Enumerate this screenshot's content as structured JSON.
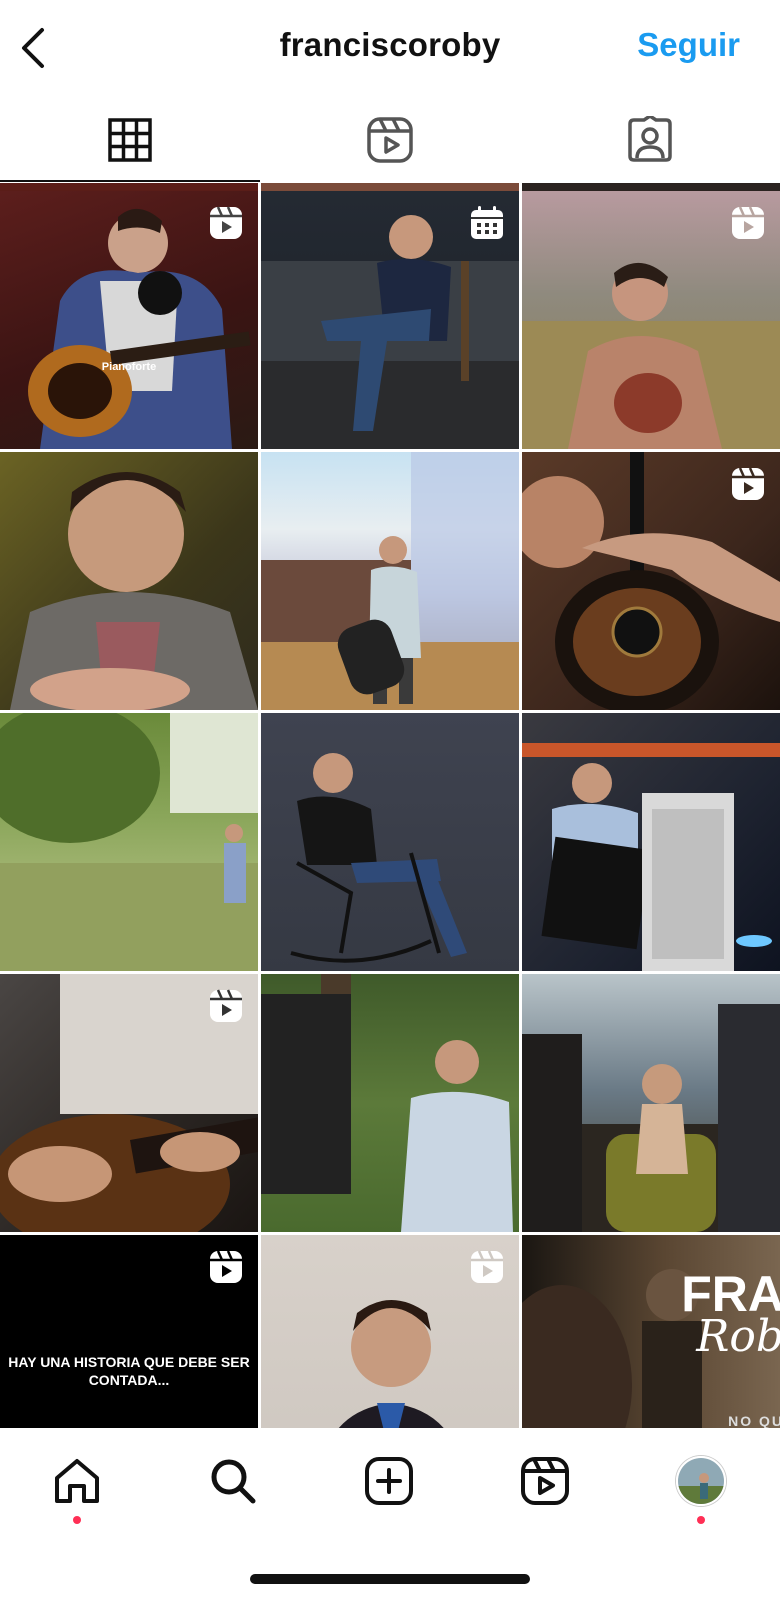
{
  "header": {
    "title": "franciscoroby",
    "follow_label": "Seguir"
  },
  "tabs": [
    {
      "name": "posts-grid",
      "icon": "grid-icon",
      "active": true
    },
    {
      "name": "reels",
      "icon": "reels-icon",
      "active": false
    },
    {
      "name": "tagged",
      "icon": "tagged-person-icon",
      "active": false
    }
  ],
  "posts": [
    {
      "badge": "reels-icon",
      "overlay": "Pianoforte"
    },
    {
      "badge": "calendar-icon"
    },
    {
      "badge": "reels-icon"
    },
    {
      "badge": ""
    },
    {
      "badge": ""
    },
    {
      "badge": "reels-icon"
    },
    {
      "badge": ""
    },
    {
      "badge": ""
    },
    {
      "badge": ""
    },
    {
      "badge": "reels-icon"
    },
    {
      "badge": ""
    },
    {
      "badge": ""
    },
    {
      "badge": "reels-icon",
      "overlay": "HAY UNA HISTORIA QUE DEBE SER CONTADA..."
    },
    {
      "badge": "reels-icon"
    },
    {
      "badge": "",
      "overlay_1": "FRA",
      "overlay_2": "Rob",
      "overlay_3": "NO QU"
    }
  ],
  "nav": {
    "items": [
      "home-icon",
      "search-icon",
      "create-post-icon",
      "reels-icon",
      "profile-avatar"
    ],
    "accent_color": "#ff2f55"
  },
  "colors": {
    "follow": "#1a9bf0"
  }
}
